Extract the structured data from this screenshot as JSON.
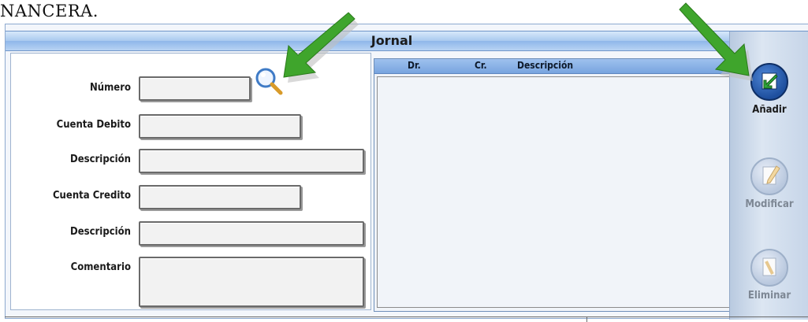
{
  "document": {
    "fragment": "NANCERA."
  },
  "window": {
    "title": "Jornal"
  },
  "form": {
    "numero_label": "Número",
    "cuenta_debito_label": "Cuenta Debito",
    "descripcion_debito_label": "Descripción",
    "cuenta_credito_label": "Cuenta Credito",
    "descripcion_credito_label": "Descripción",
    "comentario_label": "Comentario",
    "numero_value": "",
    "cuenta_debito_value": "",
    "descripcion_debito_value": "",
    "cuenta_credito_value": "",
    "descripcion_credito_value": "",
    "comentario_value": ""
  },
  "grid": {
    "columns": [
      "Dr.",
      "Cr.",
      "Descripción"
    ],
    "rows": []
  },
  "toolbar": {
    "add_label": "Añadir",
    "modify_label": "Modificar",
    "delete_label": "Eliminar"
  },
  "icons": {
    "search": "search-icon",
    "add": "add-icon",
    "modify": "modify-icon",
    "delete": "delete-icon",
    "annotation_arrow": "green-arrow-icon"
  },
  "colors": {
    "titlebar": "#a9c9ef",
    "grid_header": "#78a4df",
    "add_button": "#1e4f9e",
    "arrow": "#3fa52c"
  }
}
